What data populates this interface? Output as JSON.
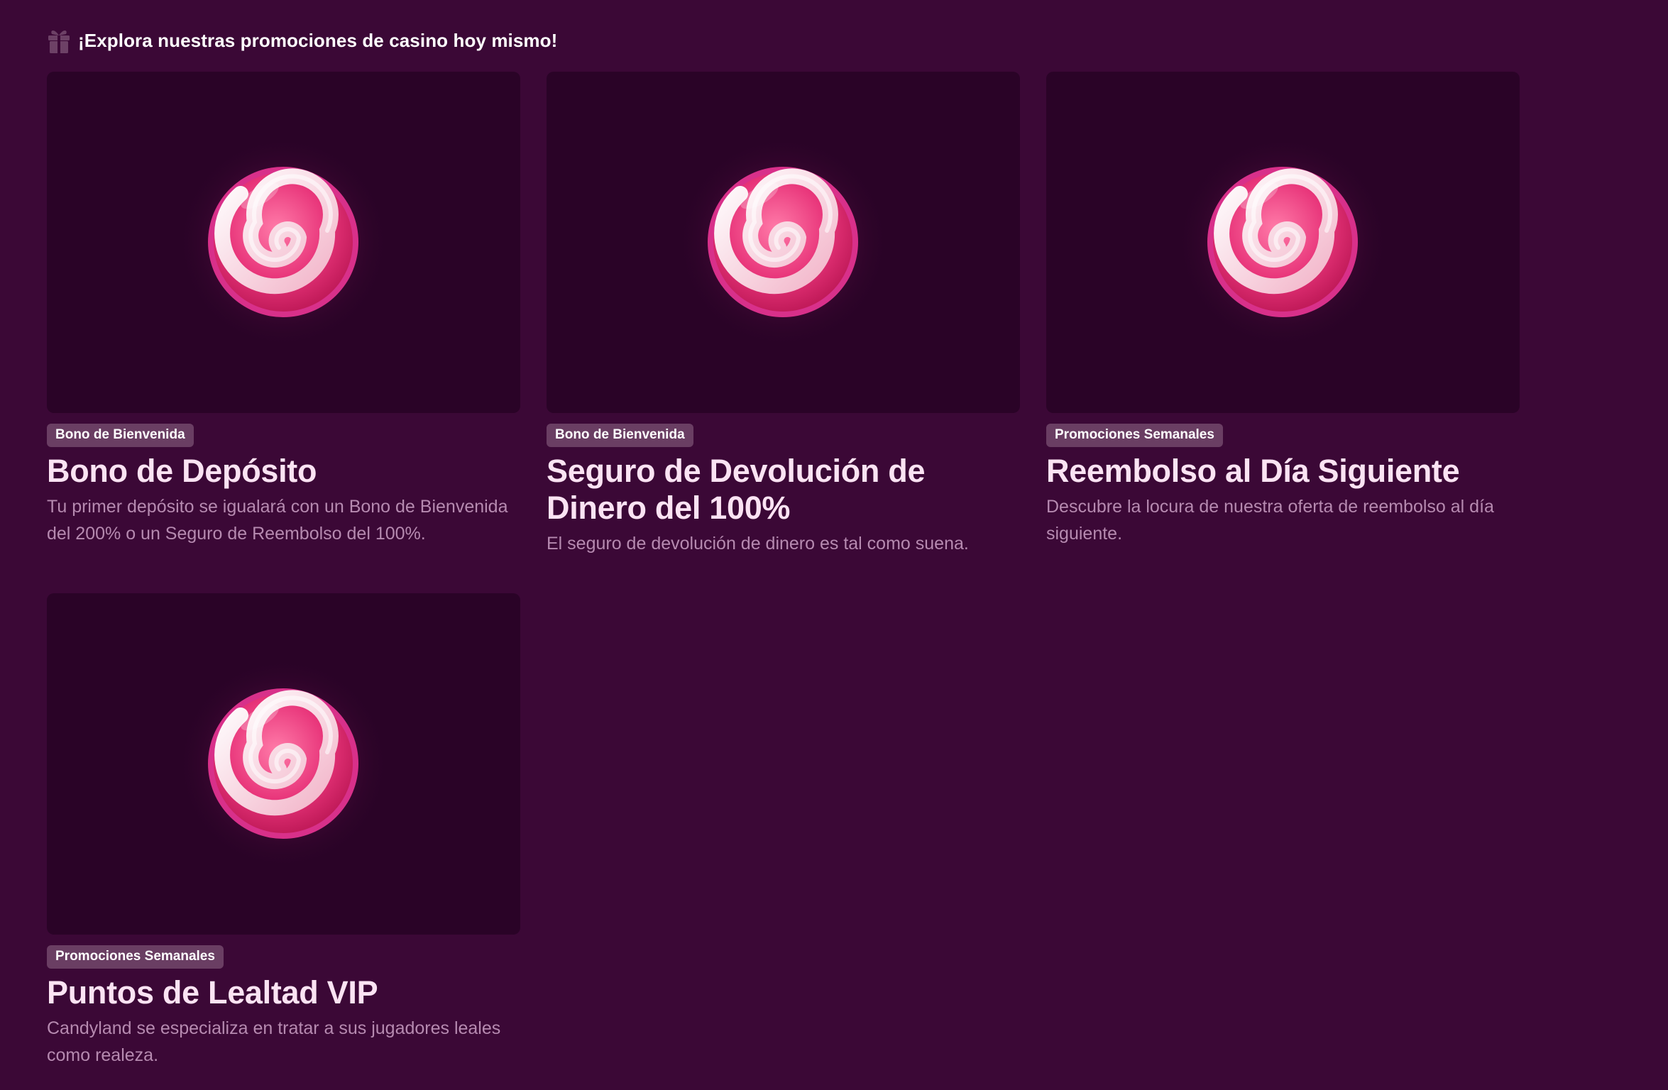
{
  "header": {
    "icon": "gift-icon",
    "title": "¡Explora nuestras promociones de casino hoy mismo!"
  },
  "colors": {
    "background": "#3b0836",
    "card_thumb": "#2a0327",
    "badge": "#6a3e63",
    "title": "#fbe3f3",
    "description": "#b68ab0",
    "candy_pink": "#e8357a",
    "candy_light": "#f7c6d6"
  },
  "promotions": [
    {
      "image": "swirl-candy-image",
      "category": "Bono de Bienvenida",
      "title": "Bono de Depósito",
      "description": "Tu primer depósito se igualará con un Bono de Bienvenida del 200% o un Seguro de Reembolso del 100%."
    },
    {
      "image": "swirl-candy-image",
      "category": "Bono de Bienvenida",
      "title": "Seguro de Devolución de Dinero del 100%",
      "description": "El seguro de devolución de dinero es tal como suena."
    },
    {
      "image": "swirl-candy-image",
      "category": "Promociones Semanales",
      "title": "Reembolso al Día Siguiente",
      "description": "Descubre la locura de nuestra oferta de reembolso al día siguiente."
    },
    {
      "image": "swirl-candy-image",
      "category": "Promociones Semanales",
      "title": "Puntos de Lealtad VIP",
      "description": "Candyland se especializa en tratar a sus jugadores leales como realeza."
    }
  ]
}
